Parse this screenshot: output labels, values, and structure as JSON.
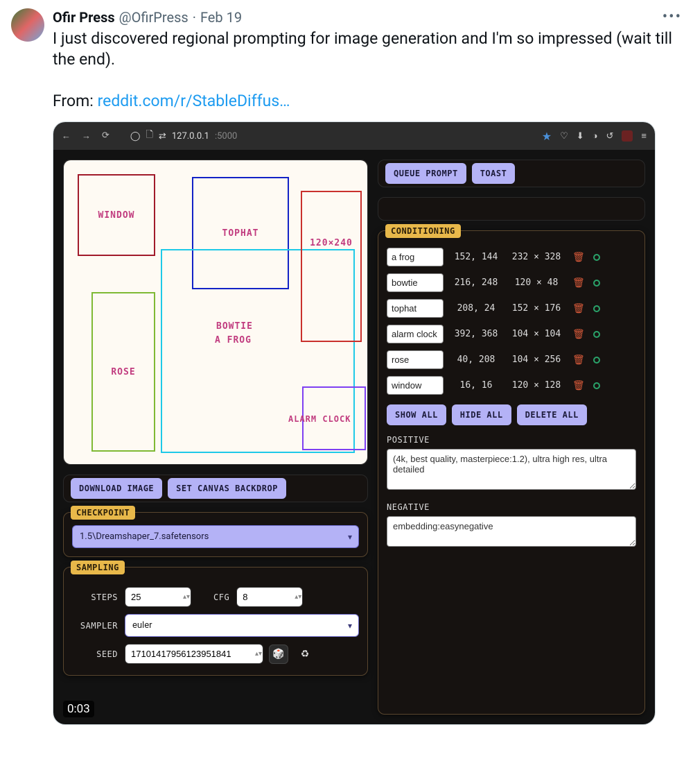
{
  "tweet": {
    "author_name": "Ofir Press",
    "author_handle": "@OfirPress",
    "separator": "·",
    "date": "Feb 19",
    "text_before": "I just discovered regional prompting for image generation and I'm so impressed (wait till the end).",
    "text_from": "From: ",
    "link_text": "reddit.com/r/StableDiffus…",
    "timecode": "0:03"
  },
  "browser": {
    "url_host": "127.0.0.1",
    "url_port": ":5000"
  },
  "topbar": {
    "queue_prompt": "QUEUE PROMPT",
    "toast": "TOAST"
  },
  "canvas": {
    "window": "WINDOW",
    "tophat": "TOPHAT",
    "rose": "ROSE",
    "bowtie": "BOWTIE",
    "a_frog": "A FROG",
    "alarm_clock": "ALARM CLOCK",
    "selection_size": "120×240"
  },
  "left_buttons": {
    "download": "DOWNLOAD IMAGE",
    "backdrop": "SET CANVAS BACKDROP"
  },
  "checkpoint": {
    "tag": "CHECKPOINT",
    "value": "1.5\\Dreamshaper_7.safetensors"
  },
  "sampling": {
    "tag": "SAMPLING",
    "steps_label": "STEPS",
    "steps_value": "25",
    "cfg_label": "CFG",
    "cfg_value": "8",
    "sampler_label": "SAMPLER",
    "sampler_value": "euler",
    "seed_label": "SEED",
    "seed_value": "17101417956123951841"
  },
  "conditioning": {
    "tag": "CONDITIONING",
    "rows": [
      {
        "name": "a frog",
        "coord": "152, 144",
        "size": "232 × 328"
      },
      {
        "name": "bowtie",
        "coord": "216, 248",
        "size": "120 × 48"
      },
      {
        "name": "tophat",
        "coord": "208, 24",
        "size": "152 × 176"
      },
      {
        "name": "alarm clock",
        "coord": "392, 368",
        "size": "104 × 104"
      },
      {
        "name": "rose",
        "coord": "40, 208",
        "size": "104 × 256"
      },
      {
        "name": "window",
        "coord": "16, 16",
        "size": "120 × 128"
      }
    ],
    "show_all": "SHOW ALL",
    "hide_all": "HIDE ALL",
    "delete_all": "DELETE ALL",
    "positive_label": "POSITIVE",
    "positive_value": "(4k, best quality, masterpiece:1.2), ultra high res, ultra detailed",
    "negative_label": "NEGATIVE",
    "negative_value": "embedding:easynegative"
  }
}
